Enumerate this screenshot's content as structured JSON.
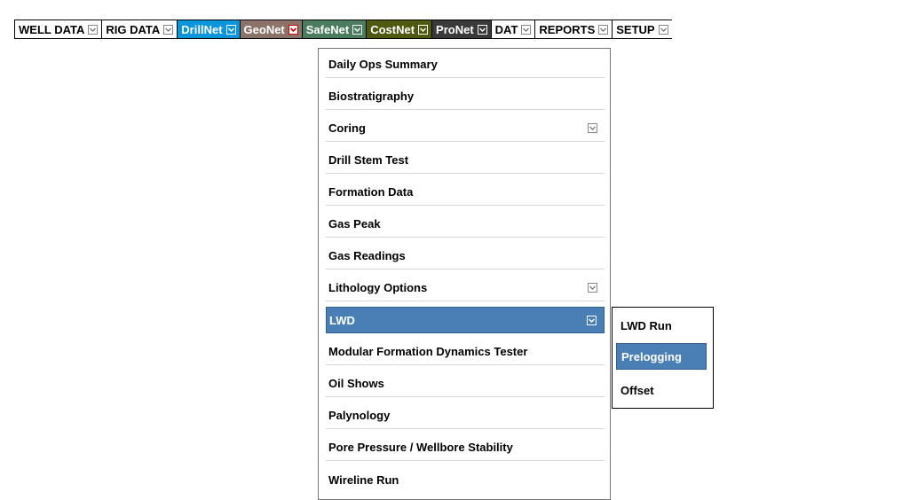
{
  "menubar": {
    "tabs": [
      {
        "label": "WELL DATA",
        "bg": "#ffffff",
        "fg": "#000000"
      },
      {
        "label": "RIG DATA",
        "bg": "#ffffff",
        "fg": "#000000"
      },
      {
        "label": "DrillNet",
        "bg": "#0b96dc",
        "fg": "#ffffff"
      },
      {
        "label": "GeoNet",
        "bg": "#8c736a",
        "fg": "#ffffff"
      },
      {
        "label": "SafeNet",
        "bg": "#4a7d5e",
        "fg": "#ffffff"
      },
      {
        "label": "CostNet",
        "bg": "#4f5a10",
        "fg": "#ffffff"
      },
      {
        "label": "ProNet",
        "bg": "#3a3a3a",
        "fg": "#ffffff"
      },
      {
        "label": "DAT",
        "bg": "#ffffff",
        "fg": "#000000"
      },
      {
        "label": "REPORTS",
        "bg": "#ffffff",
        "fg": "#000000"
      },
      {
        "label": "SETUP",
        "bg": "#ffffff",
        "fg": "#000000"
      }
    ]
  },
  "dropdown": {
    "items": [
      {
        "label": "Daily Ops Summary",
        "has_submenu": false
      },
      {
        "label": "Biostratigraphy",
        "has_submenu": false
      },
      {
        "label": "Coring",
        "has_submenu": true
      },
      {
        "label": "Drill Stem Test",
        "has_submenu": false
      },
      {
        "label": "Formation Data",
        "has_submenu": false
      },
      {
        "label": "Gas Peak",
        "has_submenu": false
      },
      {
        "label": "Gas Readings",
        "has_submenu": false
      },
      {
        "label": "Lithology Options",
        "has_submenu": true
      },
      {
        "label": "LWD",
        "has_submenu": true,
        "active": true
      },
      {
        "label": "Modular Formation Dynamics Tester",
        "has_submenu": false
      },
      {
        "label": "Oil Shows",
        "has_submenu": false
      },
      {
        "label": "Palynology",
        "has_submenu": false
      },
      {
        "label": "Pore Pressure / Wellbore Stability",
        "has_submenu": false
      },
      {
        "label": "Wireline Run",
        "has_submenu": false
      }
    ]
  },
  "submenu": {
    "items": [
      {
        "label": "LWD Run",
        "active": false
      },
      {
        "label": "Prelogging",
        "active": true
      },
      {
        "label": "Offset",
        "active": false
      }
    ]
  },
  "colors": {
    "highlight": "#4a7fb5"
  }
}
